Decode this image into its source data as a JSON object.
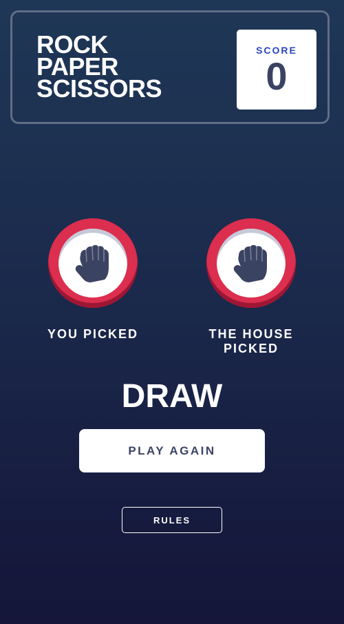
{
  "header": {
    "title_lines": [
      "ROCK",
      "PAPER",
      "SCISSORS"
    ],
    "score_label": "SCORE",
    "score_value": "0"
  },
  "picks": {
    "player": {
      "label": "YOU PICKED",
      "choice": "rock",
      "icon": "rock-fist-icon",
      "ring_color": "#dc2e4e"
    },
    "house": {
      "label": "THE HOUSE PICKED",
      "choice": "rock",
      "icon": "rock-fist-icon",
      "ring_color": "#dc2e4e"
    }
  },
  "result": {
    "text": "DRAW"
  },
  "buttons": {
    "play_again": "PLAY AGAIN",
    "rules": "RULES"
  },
  "colors": {
    "score_label": "#2a46c0",
    "dark_text": "#3b4363",
    "header_border": "#606e85"
  }
}
